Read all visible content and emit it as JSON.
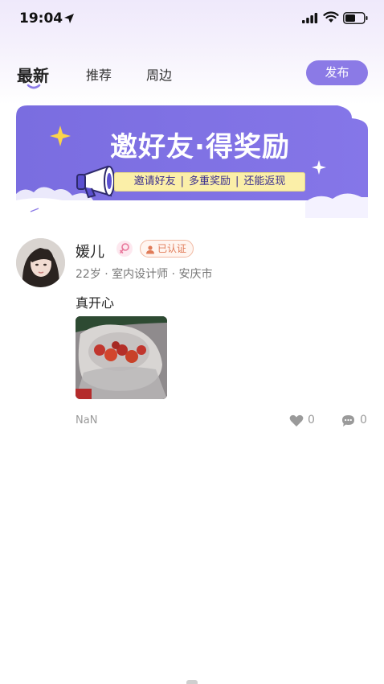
{
  "status_bar": {
    "time": "19:04"
  },
  "tabs": [
    {
      "label": "最新",
      "active": true
    },
    {
      "label": "推荐",
      "active": false
    },
    {
      "label": "周边",
      "active": false
    }
  ],
  "publish_label": "发布",
  "banner": {
    "title": "邀好友·得奖励",
    "strip_items": [
      "邀请好友",
      "多重奖励",
      "还能返现"
    ],
    "background_color": "#7b6ee0",
    "strip_color": "#fbefa8"
  },
  "post": {
    "username": "媛儿",
    "gender_icon": "female-icon",
    "verified_label": "已认证",
    "meta": "22岁 · 室内设计师 · 安庆市",
    "content": "真开心",
    "image_description_icon": "photo-strawberries",
    "date": "NaN",
    "likes": "0",
    "comments": "0"
  },
  "colors": {
    "accent": "#8b7ae6",
    "verified": "#e07b58"
  }
}
